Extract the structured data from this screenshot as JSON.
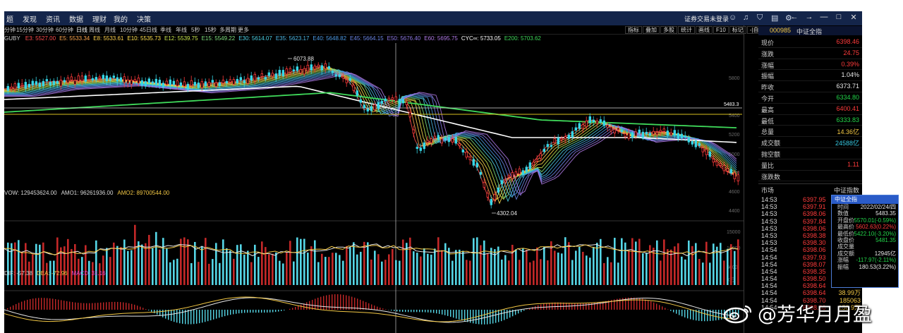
{
  "menubar": {
    "items": [
      "题",
      "发现",
      "资讯",
      "数据",
      "理财",
      "我的",
      "决策"
    ],
    "login": "证券交易未登录",
    "tool_icons": [
      "user-icon",
      "bell-icon",
      "shirt-icon",
      "notes-icon",
      "settings-icon"
    ],
    "window_controls": [
      "←",
      "→",
      "—",
      "□",
      "✕"
    ]
  },
  "periods": [
    "分钟",
    "15分钟",
    "30分钟",
    "60分钟",
    "日线",
    "周线",
    "月线",
    "10分钟",
    "45日线",
    "季线",
    "年线",
    "5秒",
    "15秒",
    "多周期",
    "更多"
  ],
  "active_period": "日线",
  "toolbar_right": [
    "指标",
    "叠加",
    "多股",
    "统计",
    "画线",
    "F10",
    "标记",
    "-|自选",
    "返回"
  ],
  "ma_legend": {
    "name": "GUBY",
    "items": [
      {
        "text": "E3: 5527.00",
        "color": "#ff4d4d"
      },
      {
        "text": "E5: 5533.34",
        "color": "#ffa64d"
      },
      {
        "text": "E8: 5533.61",
        "color": "#ffd24d"
      },
      {
        "text": "E10: 5535.73",
        "color": "#ffe14d"
      },
      {
        "text": "E12: 5539.75",
        "color": "#c8e64d"
      },
      {
        "text": "E15: 5549.22",
        "color": "#7fe07f"
      },
      {
        "text": "E30: 5614.07",
        "color": "#4dd2e6"
      },
      {
        "text": "E35: 5623.17",
        "color": "#4db8e6"
      },
      {
        "text": "E40: 5648.82",
        "color": "#4d9be6"
      },
      {
        "text": "E45: 5664.15",
        "color": "#6b86e6"
      },
      {
        "text": "E50: 5676.40",
        "color": "#8f7ae6"
      },
      {
        "text": "E60: 5695.75",
        "color": "#b07ae6"
      },
      {
        "text": "CYC∞: 5733.05",
        "color": "#ffffff"
      },
      {
        "text": "E200: 5703.62",
        "color": "#3fd95a"
      }
    ]
  },
  "price_annotations": {
    "high": "6073.88",
    "low": "4302.04",
    "hline_label": "5483.3"
  },
  "price_axis": [
    "5800",
    "5400",
    "5200",
    "5000",
    "4800",
    "4600",
    "4400"
  ],
  "volume_legend": [
    {
      "text": "VOW: 129453624.00",
      "color": "#d8d8d8"
    },
    {
      "text": "AMO1: 96261936.00",
      "color": "#d8d8d8"
    },
    {
      "text": "AMO2: 89700544.00",
      "color": "#f2c744"
    }
  ],
  "volume_axis": [
    "15000",
    "10000",
    "5000",
    "X万"
  ],
  "macd_legend": [
    {
      "text": "DIF: -57.38",
      "color": "#d8d8d8"
    },
    {
      "text": "DEA: -72.96",
      "color": "#f2c744"
    },
    {
      "text": "MACD: 31.16",
      "color": "#d94ad9"
    }
  ],
  "stock": {
    "code": "000985",
    "name": "中证全指"
  },
  "quote": [
    {
      "label": "现价",
      "value": "6398.46",
      "color": "red"
    },
    {
      "label": "涨跌",
      "value": "24.75",
      "color": "red"
    },
    {
      "label": "涨幅",
      "value": "0.39%",
      "color": "red"
    },
    {
      "label": "振幅",
      "value": "1.04%",
      "color": "white"
    },
    {
      "label": "昨收",
      "value": "6373.71",
      "color": "white"
    },
    {
      "label": "今开",
      "value": "6334.80",
      "color": "green"
    },
    {
      "label": "最高",
      "value": "6400.41",
      "color": "red"
    },
    {
      "label": "最低",
      "value": "6333.83",
      "color": "green"
    },
    {
      "label": "总量",
      "value": "14.36亿",
      "color": "yellow"
    },
    {
      "label": "成交额",
      "value": "24588亿",
      "color": "cyan"
    },
    {
      "label": "抛空额",
      "value": "",
      "color": "white"
    },
    {
      "label": "量比",
      "value": "1.11",
      "color": "red"
    },
    {
      "label": "涨跌数",
      "value": "",
      "color": "white"
    }
  ],
  "tick_header": {
    "left": "市场",
    "right": "中证指数"
  },
  "ticks": [
    {
      "time": "14:53",
      "price": "6397.95",
      "vol": ""
    },
    {
      "time": "14:53",
      "price": "6397.91",
      "vol": ""
    },
    {
      "time": "14:53",
      "price": "6398.06",
      "vol": ""
    },
    {
      "time": "14:53",
      "price": "6397.84",
      "vol": ""
    },
    {
      "time": "14:53",
      "price": "6398.06",
      "vol": ""
    },
    {
      "time": "14:53",
      "price": "6398.38",
      "vol": ""
    },
    {
      "time": "14:53",
      "price": "6398.30",
      "vol": ""
    },
    {
      "time": "14:54",
      "price": "6398.06",
      "vol": ""
    },
    {
      "time": "14:54",
      "price": "6397.93",
      "vol": ""
    },
    {
      "time": "14:54",
      "price": "6398.07",
      "vol": ""
    },
    {
      "time": "14:54",
      "price": "6398.35",
      "vol": ""
    },
    {
      "time": "14:54",
      "price": "6398.50",
      "vol": "895094"
    },
    {
      "time": "14:54",
      "price": "6398.64",
      "vol": "573175"
    },
    {
      "time": "14:54",
      "price": "6398.64",
      "vol": "38.99万"
    },
    {
      "time": "14:54",
      "price": "6398.70",
      "vol": "185063"
    },
    {
      "time": "14:54",
      "price": "6398.80",
      "vol": "158.9万"
    }
  ],
  "info_box": {
    "title": "中证全指",
    "rows": [
      {
        "label": "时间",
        "value": "2022/02/24/四",
        "color": "white"
      },
      {
        "label": "数值",
        "value": "5483.35",
        "color": "white"
      },
      {
        "label": "开盘价",
        "value": "5570.01(-0.59%)",
        "color": "green"
      },
      {
        "label": "最高价",
        "value": "5602.63(0.22%)",
        "color": "red"
      },
      {
        "label": "最低价",
        "value": "5422.10(-3.20%)",
        "color": "green"
      },
      {
        "label": "收盘价",
        "value": "5481.35",
        "color": "green"
      },
      {
        "label": "成交量",
        "value": "",
        "color": "white"
      },
      {
        "label": "成交额",
        "value": "12945亿",
        "color": "white"
      },
      {
        "label": "涨幅",
        "value": "-117.97(-2.11%)",
        "color": "green"
      },
      {
        "label": "振幅",
        "value": "180.53(3.22%)",
        "color": "white"
      }
    ]
  },
  "watermark": {
    "text": "@芳华月月盈",
    "logo_icon": "weibo-logo"
  }
}
